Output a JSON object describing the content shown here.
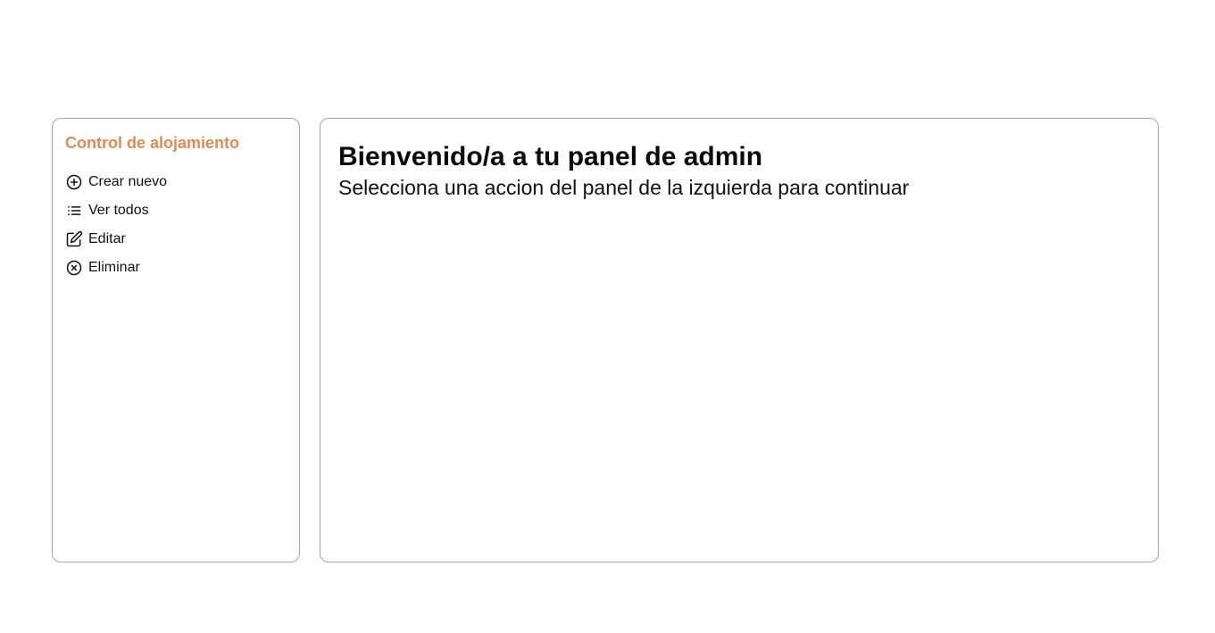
{
  "sidebar": {
    "title": "Control de alojamiento",
    "title_color": "#e08a55",
    "items": [
      {
        "label": "Crear nuevo",
        "icon": "plus-circle-icon"
      },
      {
        "label": "Ver todos",
        "icon": "list-icon"
      },
      {
        "label": "Editar",
        "icon": "edit-icon"
      },
      {
        "label": "Eliminar",
        "icon": "x-circle-icon"
      }
    ]
  },
  "main": {
    "title": "Bienvenido/a a tu panel de admin",
    "subtitle": "Selecciona una accion del panel de la izquierda para continuar"
  }
}
